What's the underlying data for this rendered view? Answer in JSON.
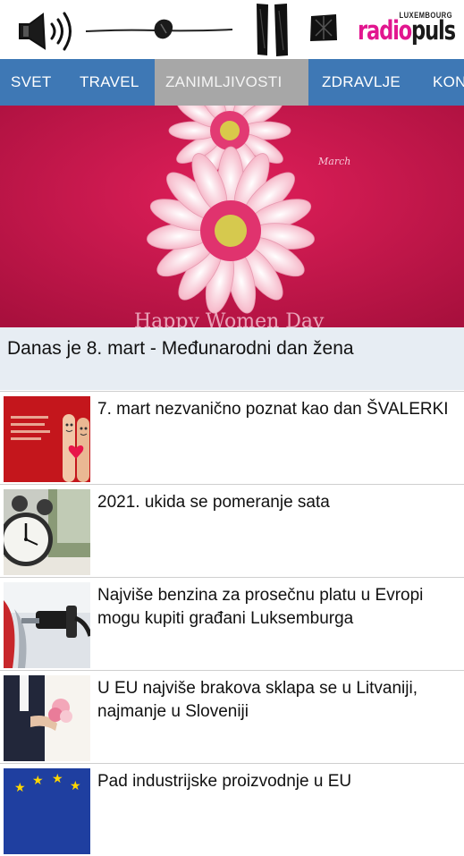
{
  "player": {
    "speaker_icon": "speaker-icon",
    "slider_icon": "volume-slider",
    "pause_icon": "pause-icon",
    "stop_icon": "stop-icon",
    "volume_level": 0.5
  },
  "logo": {
    "top_text": "LUXEMBOURG",
    "radio_text": "radio",
    "puls_text": "puls",
    "radio_color": "#e2168f"
  },
  "nav": {
    "tabs": [
      {
        "label": "SVET"
      },
      {
        "label": "TRAVEL"
      },
      {
        "label": "ZANIMLJIVOSTI",
        "active": true
      },
      {
        "label": "ZDRAVLJE"
      },
      {
        "label": "KON"
      }
    ],
    "background": "#3e78b5",
    "active_background": "#a7a7a7"
  },
  "hero": {
    "caption": "Danas je 8. mart - Međunarodni dan žena",
    "image_text_small": "March",
    "image_text_bottom": "Happy Women Day"
  },
  "articles": [
    {
      "title": "7. mart nezvanično poznat kao dan ŠVALERKI",
      "thumb": "fingers-heart"
    },
    {
      "title": "2021. ukida se pomeranje sata",
      "thumb": "alarm-clock"
    },
    {
      "title": "Najviše benzina za prosečnu platu u Evropi mogu kupiti građani Luksemburga",
      "thumb": "fuel-nozzle"
    },
    {
      "title": "U EU najviše brakova sklapa se u Litvaniji, najmanje u Sloveniji",
      "thumb": "wedding-couple"
    },
    {
      "title": "Pad industrijske proizvodnje u EU",
      "thumb": "eu-flag"
    }
  ]
}
